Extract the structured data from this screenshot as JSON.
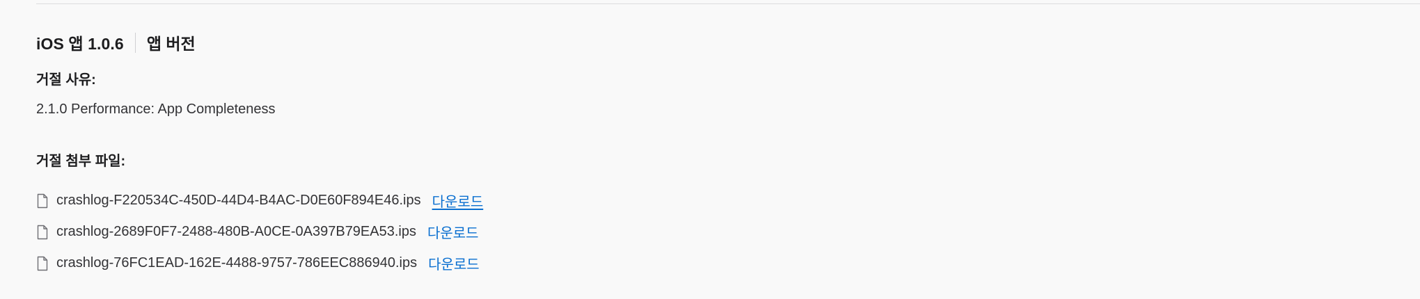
{
  "header": {
    "version_title": "iOS 앱 1.0.6",
    "version_label": "앱 버전"
  },
  "rejection": {
    "reason_label": "거절 사유:",
    "reason_text": "2.1.0 Performance: App Completeness",
    "attachments_label": "거절 첨부 파일:"
  },
  "attachments": [
    {
      "filename": "crashlog-F220534C-450D-44D4-B4AC-D0E60F894E46.ips",
      "link": "다운로드"
    },
    {
      "filename": "crashlog-2689F0F7-2488-480B-A0CE-0A397B79EA53.ips",
      "link": "다운로드"
    },
    {
      "filename": "crashlog-76FC1EAD-162E-4488-9757-786EEC886940.ips",
      "link": "다운로드"
    }
  ],
  "colors": {
    "link": "#0a6fd0",
    "text": "#1d1d1f",
    "background": "#f9f9f9"
  },
  "icons": {
    "file": "document-icon"
  }
}
